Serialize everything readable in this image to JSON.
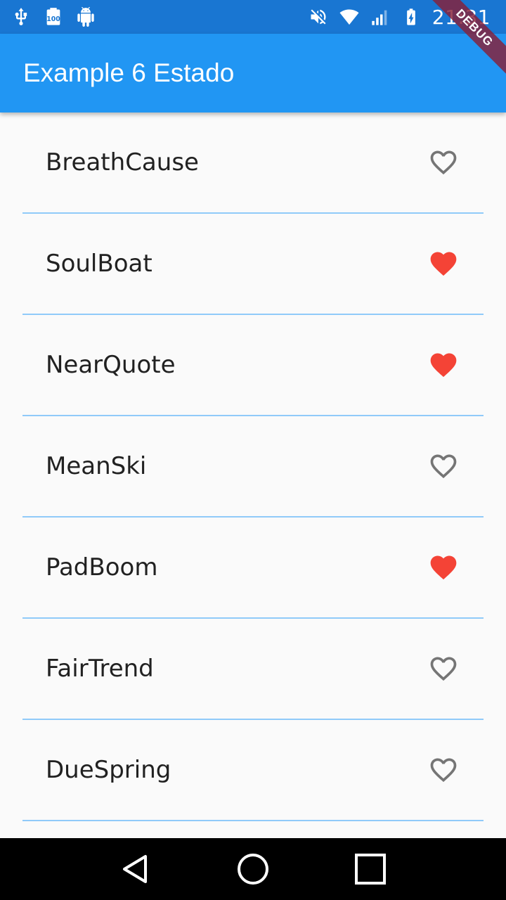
{
  "status_bar": {
    "time": "21:31",
    "left_icons": [
      "usb-icon",
      "battery-100-notification-icon",
      "android-debug-icon"
    ],
    "right_icons": [
      "mute-icon",
      "wifi-icon",
      "signal-icon",
      "battery-charging-icon"
    ]
  },
  "app_bar": {
    "title": "Example 6 Estado",
    "debug_label": "DEBUG"
  },
  "colors": {
    "favorite": "#f44336",
    "not_favorite": "#757575",
    "divider": "#90caf9",
    "app_bar": "#2196f3"
  },
  "items": [
    {
      "label": "BreathCause",
      "favorite": false
    },
    {
      "label": "SoulBoat",
      "favorite": true
    },
    {
      "label": "NearQuote",
      "favorite": true
    },
    {
      "label": "MeanSki",
      "favorite": false
    },
    {
      "label": "PadBoom",
      "favorite": true
    },
    {
      "label": "FairTrend",
      "favorite": false
    },
    {
      "label": "DueSpring",
      "favorite": false
    },
    {
      "label": "",
      "favorite": false
    }
  ],
  "nav": [
    "back-icon",
    "home-icon",
    "recents-icon"
  ]
}
